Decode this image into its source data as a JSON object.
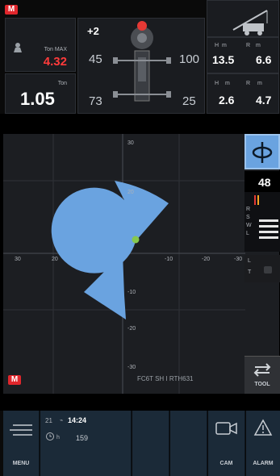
{
  "top_left": {
    "load_label": "Ton MAX",
    "load_value": "4.32",
    "weight_label": "Ton",
    "weight_value": "1.05"
  },
  "center": {
    "tilt": "+2",
    "tl": "45",
    "tr": "100",
    "bl": "73",
    "br": "25"
  },
  "top_right": {
    "height_value": "13.5",
    "radius_value": "6.6",
    "hook_height_value": "2.6",
    "hook_radius_value": "4.7",
    "unit_m": "m",
    "letter_h": "H",
    "letter_r": "R"
  },
  "right_bar": {
    "count": "48",
    "letters": [
      "R",
      "S",
      "W",
      "L"
    ],
    "lt_letters": [
      "L",
      "T"
    ],
    "tool_label": "TOOL"
  },
  "map": {
    "model_label": "FC6T SH I RTH631",
    "x_ticks": [
      "30",
      "20",
      "-10",
      "-20",
      "-30"
    ],
    "y_ticks": [
      "30",
      "20",
      "-10",
      "-20",
      "-30"
    ]
  },
  "bottom": {
    "menu_label": "MENU",
    "num_small": "21",
    "time": "14:24",
    "hours_unit": "h",
    "hours": "159",
    "cam_label": "CAM",
    "alarm_label": "ALARM"
  },
  "colors": {
    "accent_blue": "#6aa3e0",
    "alert_red": "#ff3b3b",
    "dot_green": "#86c84e"
  }
}
